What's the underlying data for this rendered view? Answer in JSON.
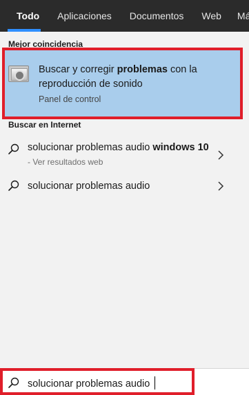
{
  "tabs": [
    {
      "label": "Todo",
      "active": true
    },
    {
      "label": "Aplicaciones",
      "active": false
    },
    {
      "label": "Documentos",
      "active": false
    },
    {
      "label": "Web",
      "active": false
    },
    {
      "label": "Más",
      "active": false
    }
  ],
  "best_match": {
    "section_title": "Mejor coincidencia",
    "title_prefix": "Buscar y corregir ",
    "title_bold": "problemas",
    "title_suffix": " con la reproducción de sonido",
    "subtitle": "Panel de control",
    "icon": "speaker-control-panel-icon"
  },
  "web_search": {
    "section_title": "Buscar en Internet",
    "results": [
      {
        "text": "solucionar problemas audio ",
        "bold": "windows 10",
        "hint": " - Ver resultados web"
      },
      {
        "text": "solucionar problemas audio",
        "bold": "",
        "hint": ""
      }
    ]
  },
  "search": {
    "value": "solucionar problemas audio",
    "icon": "search-icon"
  },
  "colors": {
    "tabbar_bg": "#2b2b2b",
    "tab_accent": "#2f8fff",
    "best_match_bg": "#a9cdec",
    "highlight_border": "#e01e2a"
  }
}
